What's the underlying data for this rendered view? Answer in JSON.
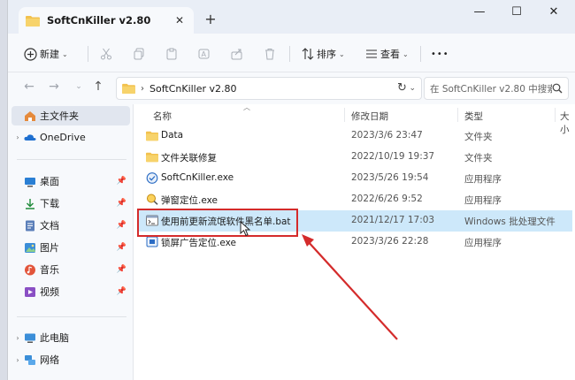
{
  "window": {
    "tab_title": "SoftCnKiller v2.80",
    "tab_close": "✕",
    "new_tab": "+",
    "minimize": "—",
    "maximize": "☐",
    "close": "✕"
  },
  "toolbar": {
    "new_label": "新建",
    "sort_label": "排序",
    "view_label": "查看",
    "more": "•••"
  },
  "address": {
    "path": "SoftCnKiller v2.80",
    "search_placeholder": "在 SoftCnKiller v2.80 中搜索"
  },
  "sidebar": {
    "home": "主文件夹",
    "onedrive": "OneDrive",
    "desktop": "桌面",
    "downloads": "下载",
    "documents": "文档",
    "pictures": "图片",
    "music": "音乐",
    "videos": "视频",
    "this_pc": "此电脑",
    "network": "网络"
  },
  "columns": {
    "name": "名称",
    "modified": "修改日期",
    "type": "类型",
    "size": "大小"
  },
  "files": [
    {
      "name": "Data",
      "date": "2023/3/6 23:47",
      "type": "文件夹",
      "icon": "folder-icon"
    },
    {
      "name": "文件关联修复",
      "date": "2022/10/19 19:37",
      "type": "文件夹",
      "icon": "folder-icon"
    },
    {
      "name": "SoftCnKiller.exe",
      "date": "2023/5/26 19:54",
      "type": "应用程序",
      "icon": "app-icon"
    },
    {
      "name": "弹窗定位.exe",
      "date": "2022/6/26 9:52",
      "type": "应用程序",
      "icon": "magnifier-app-icon"
    },
    {
      "name": "使用前更新流氓软件黑名单.bat",
      "date": "2021/12/17 17:03",
      "type": "Windows 批处理文件",
      "icon": "batch-file-icon"
    },
    {
      "name": "锁屏广告定位.exe",
      "date": "2023/3/26 22:28",
      "type": "应用程序",
      "icon": "app-icon"
    }
  ],
  "colors": {
    "accent_selection": "#cde8fa",
    "annotation_red": "#d42b2b",
    "folder_yellow": "#f2c14e"
  }
}
